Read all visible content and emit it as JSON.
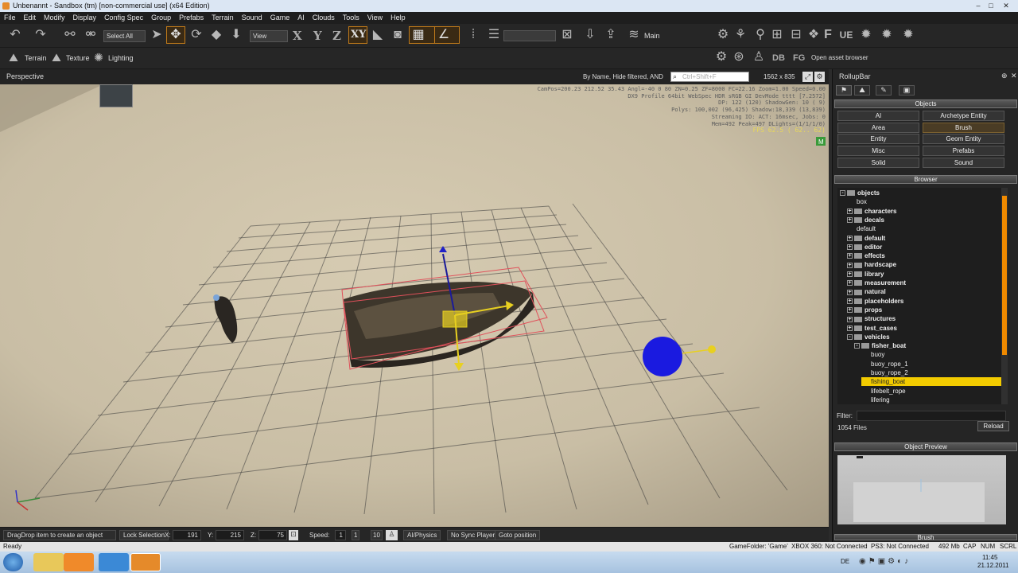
{
  "window": {
    "title": "Unbenannt - Sandbox (tm) [non-commercial use] (x64 Edition)"
  },
  "menu": [
    "File",
    "Edit",
    "Modify",
    "Display",
    "Config Spec",
    "Group",
    "Prefabs",
    "Terrain",
    "Sound",
    "Game",
    "AI",
    "Clouds",
    "Tools",
    "View",
    "Help"
  ],
  "toolbar": {
    "select_all": "Select All",
    "view": "View",
    "axis_x": "X",
    "axis_y": "Y",
    "axis_z": "Z",
    "axis_xy": "XY",
    "main": "Main",
    "terrain": "Terrain",
    "texture": "Texture",
    "lighting": "Lighting",
    "db": "DB",
    "fg": "FG",
    "asset_browser": "Open asset browser"
  },
  "viewport": {
    "title": "Perspective",
    "filter_text": "By Name, Hide filtered, AND",
    "search_placeholder": "Ctrl+Shift+F",
    "resolution": "1562 x 835",
    "hud": [
      "CamPos=200.23 212.52 35.43 Angl=-40  0  80 ZN=0.25 ZF=8000 FC=22.16 Zoom=1.00 Speed=0.00",
      "DX9 Profile 64bit WebSpec HDR sRGB GI DevMode tttt [7.2572]",
      "DP: 122 (120) ShadowGen: 10 ( 9)",
      "Polys: 100,002 (96,425) Shadow:18,339 (13,839)",
      "Streaming IO: ACT: 16msec, Jobs: 0",
      "Mem=492 Peak=497 DLights=(1/1/1/0)"
    ],
    "fps": "FPS  62.5 ( 62.. 62)"
  },
  "status_row": {
    "hint": "DragDrop item to create an object",
    "lock": "Lock Selection",
    "x_label": "X:",
    "x_val": "191",
    "y_label": "Y:",
    "y_val": "215",
    "z_label": "Z:",
    "z_val": "75",
    "speed_label": "Speed:",
    "speed_1": "1",
    "speed_2": "1",
    "speed_3": "10",
    "ai_physics": "AI/Physics",
    "no_sync": "No Sync Player",
    "goto": "Goto position"
  },
  "statusbar": {
    "ready": "Ready",
    "gamefolder": "GameFolder: 'Game'",
    "xbox": "XBOX 360: Not Connected",
    "ps3": "PS3: Not Connected",
    "mem": "492 Mb",
    "cap": "CAP",
    "num": "NUM",
    "scrl": "SCRL"
  },
  "rollup": {
    "title": "RollupBar",
    "objects_header": "Objects",
    "buttons": [
      "AI",
      "Archetype Entity",
      "Area",
      "Brush",
      "Entity",
      "Geom Entity",
      "Misc",
      "Prefabs",
      "Solid",
      "Sound"
    ],
    "browser_header": "Browser",
    "tree": [
      {
        "label": "objects",
        "level": 0,
        "bold": true,
        "exp": "-"
      },
      {
        "label": "box",
        "level": 1,
        "bold": false,
        "exp": ""
      },
      {
        "label": "characters",
        "level": 1,
        "bold": true,
        "exp": "+"
      },
      {
        "label": "decals",
        "level": 1,
        "bold": true,
        "exp": "+"
      },
      {
        "label": "default",
        "level": 1,
        "bold": false,
        "exp": ""
      },
      {
        "label": "default",
        "level": 1,
        "bold": true,
        "exp": "+"
      },
      {
        "label": "editor",
        "level": 1,
        "bold": true,
        "exp": "+"
      },
      {
        "label": "effects",
        "level": 1,
        "bold": true,
        "exp": "+"
      },
      {
        "label": "hardscape",
        "level": 1,
        "bold": true,
        "exp": "+"
      },
      {
        "label": "library",
        "level": 1,
        "bold": true,
        "exp": "+"
      },
      {
        "label": "measurement",
        "level": 1,
        "bold": true,
        "exp": "+"
      },
      {
        "label": "natural",
        "level": 1,
        "bold": true,
        "exp": "+"
      },
      {
        "label": "placeholders",
        "level": 1,
        "bold": true,
        "exp": "+"
      },
      {
        "label": "props",
        "level": 1,
        "bold": true,
        "exp": "+"
      },
      {
        "label": "structures",
        "level": 1,
        "bold": true,
        "exp": "+"
      },
      {
        "label": "test_cases",
        "level": 1,
        "bold": true,
        "exp": "+"
      },
      {
        "label": "vehicles",
        "level": 1,
        "bold": true,
        "exp": "-"
      },
      {
        "label": "fisher_boat",
        "level": 2,
        "bold": true,
        "exp": "-"
      },
      {
        "label": "buoy",
        "level": 3,
        "bold": false,
        "exp": ""
      },
      {
        "label": "buoy_rope_1",
        "level": 3,
        "bold": false,
        "exp": ""
      },
      {
        "label": "buoy_rope_2",
        "level": 3,
        "bold": false,
        "exp": ""
      },
      {
        "label": "fishing_boat",
        "level": 3,
        "bold": false,
        "exp": "",
        "selected": true
      },
      {
        "label": "lifebelt_rope",
        "level": 3,
        "bold": false,
        "exp": ""
      },
      {
        "label": "lifering",
        "level": 3,
        "bold": false,
        "exp": ""
      }
    ],
    "filter_label": "Filter:",
    "files_count": "1054 Files",
    "reload": "Reload",
    "preview_header": "Object Preview",
    "bottom_header": "Brush"
  },
  "taskbar": {
    "lang": "DE",
    "time": "11:45",
    "date": "21.12.2011"
  },
  "colors": {
    "accent": "#f08a00",
    "selection": "#f2cb00"
  }
}
